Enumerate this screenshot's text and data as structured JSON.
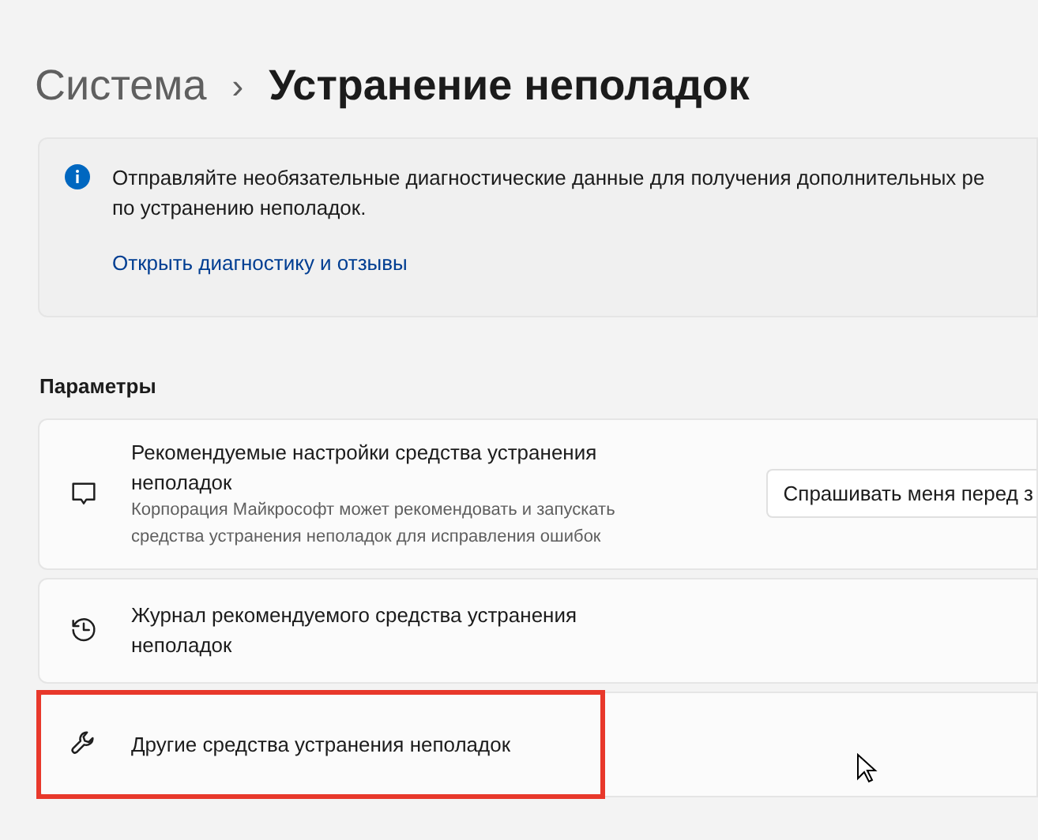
{
  "breadcrumb": {
    "parent": "Система",
    "separator": "›",
    "current": "Устранение неполадок"
  },
  "info": {
    "lines": [
      "Отправляйте необязательные диагностические данные для получения дополнительных ре",
      "по устранению неполадок."
    ],
    "link": "Открыть диагностику и отзывы"
  },
  "section_title": "Параметры",
  "rows": [
    {
      "kind": "dropdown",
      "title": "Рекомендуемые настройки средства устранения неполадок",
      "description": "Корпорация Майкрософт может рекомендовать и запускать средства устранения неполадок для исправления ошибок",
      "value": "Спрашивать меня перед з",
      "highlighted": false
    },
    {
      "kind": "link",
      "title": "Журнал рекомендуемого средства устранения неполадок",
      "highlighted": false
    },
    {
      "kind": "link",
      "title": "Другие средства устранения неполадок",
      "highlighted": true
    }
  ]
}
